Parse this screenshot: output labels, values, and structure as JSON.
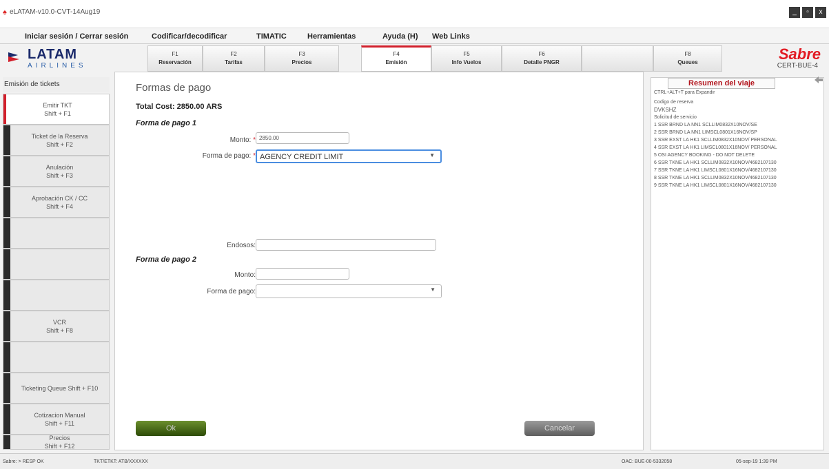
{
  "window": {
    "title": "eLATAM-v10.0-CVT-14Aug19",
    "controls": [
      "_",
      "▫",
      "x"
    ]
  },
  "menu": [
    "Iniciar sesión / Cerrar sesión",
    "Codificar/decodificar",
    "TIMATIC",
    "Herramientas",
    "Ayuda (H)",
    "Web Links"
  ],
  "brand": {
    "latam": "LATAM",
    "airlines": "AIRLINES",
    "sabre": "Sabre",
    "cert": "CERT-BUE-4"
  },
  "fkeys": [
    {
      "key": "F1",
      "name": "Reservación"
    },
    {
      "key": "F2",
      "name": "Tarifas"
    },
    {
      "key": "F3",
      "name": "Precios"
    },
    {
      "key": "F4",
      "name": "Emisión"
    },
    {
      "key": "F5",
      "name": "Info Vuelos"
    },
    {
      "key": "F6",
      "name": "Detalle PNGR"
    },
    {
      "key": "",
      "name": ""
    },
    {
      "key": "F8",
      "name": "Queues"
    }
  ],
  "sidebar": {
    "header": "Emisión de tickets",
    "items": [
      {
        "label": "Emitir TKT",
        "shortcut": "Shift + F1"
      },
      {
        "label": "Ticket de la Reserva",
        "shortcut": "Shift + F2"
      },
      {
        "label": "Anulación",
        "shortcut": "Shift + F3"
      },
      {
        "label": "Aprobación CK / CC",
        "shortcut": "Shift + F4"
      },
      {
        "label": "",
        "shortcut": ""
      },
      {
        "label": "",
        "shortcut": ""
      },
      {
        "label": "",
        "shortcut": ""
      },
      {
        "label": "VCR",
        "shortcut": "Shift + F8"
      },
      {
        "label": "",
        "shortcut": ""
      },
      {
        "label": "Ticketing Queue Shift + F10",
        "shortcut": ""
      },
      {
        "label": "Cotizacion Manual",
        "shortcut": "Shift + F11"
      },
      {
        "label": "Precios",
        "shortcut": "Shift + F12"
      }
    ]
  },
  "form": {
    "title": "Formas de pago",
    "total": "Total Cost: 2850.00 ARS",
    "fp1": {
      "heading": "Forma de pago 1",
      "monto_label": "Monto:",
      "monto_value": "2850.00",
      "forma_label": "Forma de pago:",
      "forma_value": "AGENCY CREDIT LIMIT"
    },
    "endoso_label": "Endosos:",
    "endoso_value": "",
    "fp2": {
      "heading": "Forma de pago 2",
      "monto_label": "Monto:",
      "monto_value": "",
      "forma_label": "Forma de pago:",
      "forma_value": ""
    },
    "ok": "Ok",
    "cancel": "Cancelar"
  },
  "trip": {
    "title": "Resumen del viaje",
    "hint": "CTRL+ALT+T para Expandir",
    "code_label": "Codigo de reserva",
    "code": "DVKSHZ",
    "ssr_label": "Solicitud de servicio",
    "lines": [
      "1 SSR BRND LA NN1 SCLLIM0832X10NOV/SE",
      "2 SSR BRND LA NN1 LIMSCL0801X16NOV/SP",
      "3 SSR EXST LA HK1 SCLLIM0832X10NOV/ PERSONAL",
      "4 SSR EXST LA HK1 LIMSCL0801X16NOV/ PERSONAL",
      "5 OSI AGENCY BOOKING - DO NOT DELETE",
      "6 SSR TKNE LA HK1 SCLLIM0832X10NOV/4682107130",
      "7 SSR TKNE LA HK1 LIMSCL0801X16NOV/4682107130",
      "8 SSR TKNE LA HK1 SCLLIM0832X10NOV/4682107130",
      "9 SSR TKNE LA HK1 LIMSCL0801X16NOV/4682107130"
    ]
  },
  "status": {
    "left": "Sabre: > RESP OK",
    "mid": "TKT/ETKT: ATB/XXXXXX",
    "right1": "OAC: BUE-00-5332058",
    "right2": "05-sep-19 1:39 PM"
  },
  "colors": {
    "accent": "#d21f2b",
    "ok": "#3a5c12",
    "cancel": "#7a7a7a",
    "focus": "#4a8de0"
  }
}
